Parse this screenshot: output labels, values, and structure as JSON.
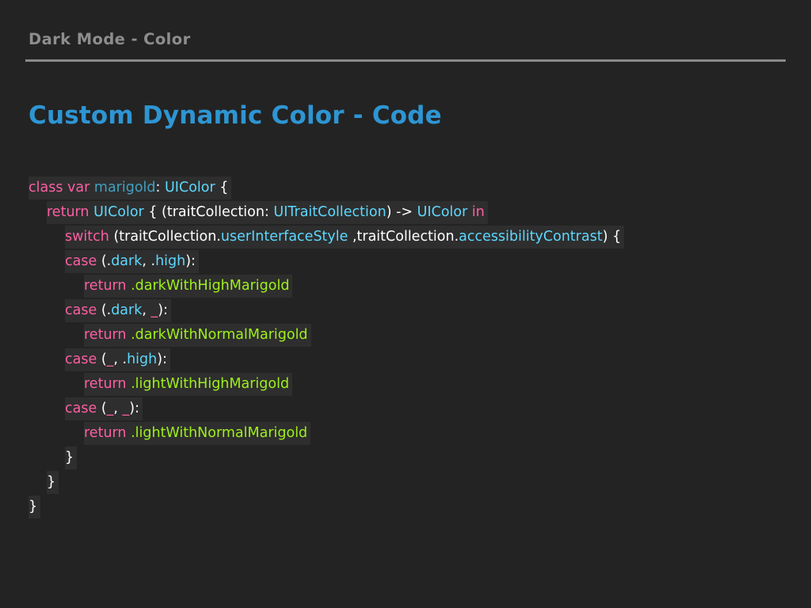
{
  "slide": {
    "section_title": "Dark Mode - Color",
    "title": "Custom Dynamic Color - Code"
  },
  "code": {
    "l1": [
      "class",
      "var",
      "marigold",
      ":",
      "UIColor",
      "{"
    ],
    "l2": [
      "return",
      "UIColor",
      "{ (traitCollection:",
      "UITraitCollection",
      ") ->",
      "UIColor",
      "in"
    ],
    "l3": [
      "switch",
      "(traitCollection.",
      "userInterfaceStyle",
      " ,traitCollection.",
      "accessibilityContrast",
      ") {"
    ],
    "l4": [
      "case",
      "(.",
      "dark",
      ", .",
      "high",
      "):"
    ],
    "l5": [
      "return",
      ".darkWithHighMarigold"
    ],
    "l6": [
      "case",
      "(.",
      "dark",
      ", ",
      "_",
      "):"
    ],
    "l7": [
      "return",
      ".darkWithNormalMarigold"
    ],
    "l8": [
      "case",
      "(",
      "_",
      ", .",
      "high",
      "):"
    ],
    "l9": [
      "return",
      ".lightWithHighMarigold"
    ],
    "l10": [
      "case",
      "(",
      "_",
      ", ",
      "_",
      "):"
    ],
    "l11": [
      "return",
      ".lightWithNormalMarigold"
    ],
    "l12": [
      "}"
    ],
    "l13": [
      "}"
    ],
    "l14": [
      "}"
    ]
  },
  "colors": {
    "background": "#232323",
    "title": "#2e95d3",
    "keyword": "#fc5fa3",
    "type": "#5dd8ff",
    "property": "#41a1c0",
    "member": "#9ef01a"
  }
}
